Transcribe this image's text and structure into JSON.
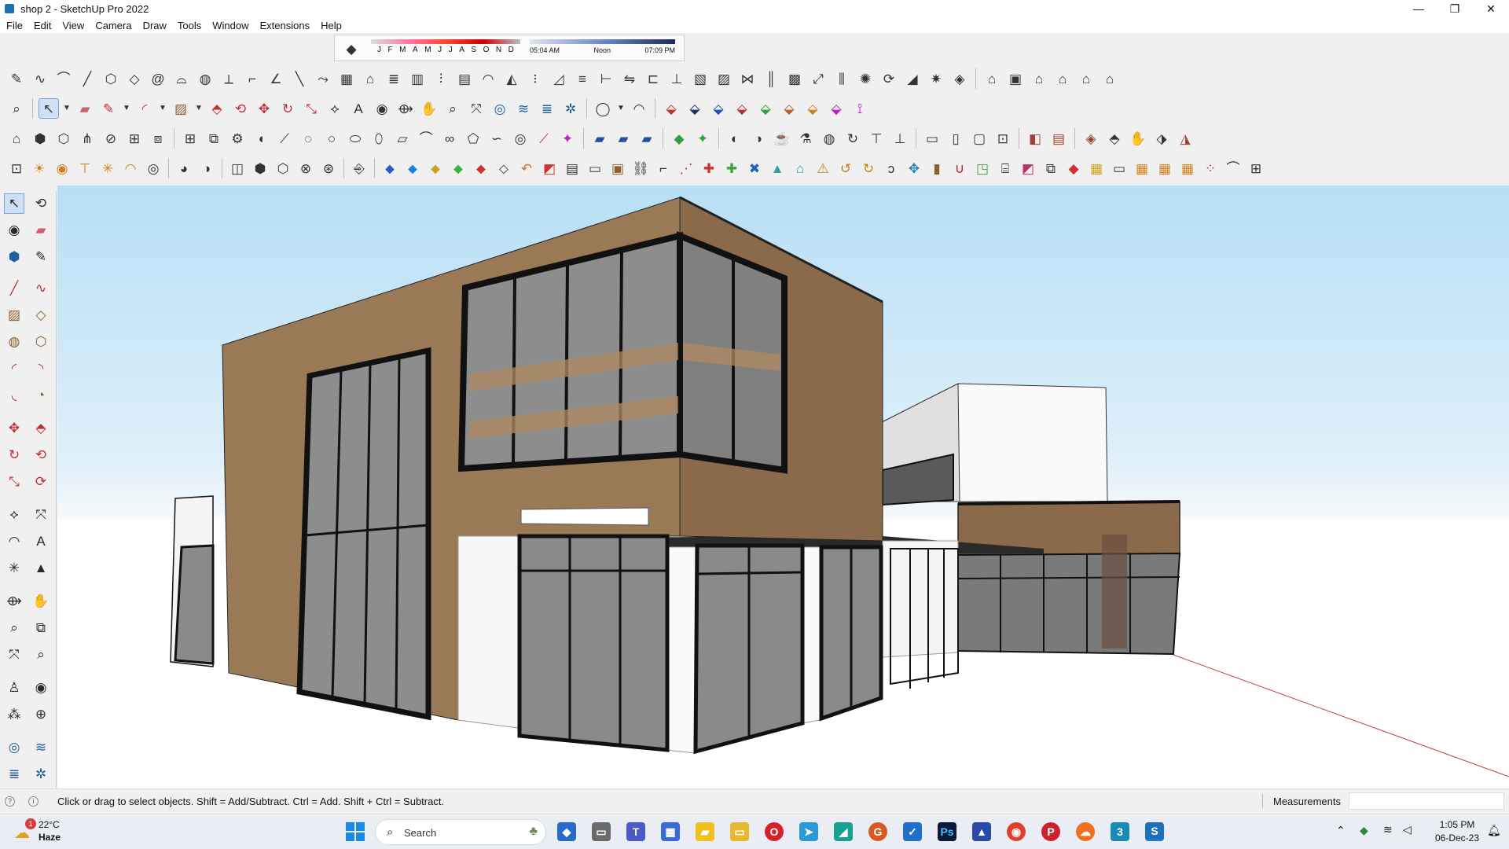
{
  "window": {
    "title": "shop 2 - SketchUp Pro 2022",
    "controls": [
      "—",
      "❐",
      "✕"
    ]
  },
  "menu": [
    "File",
    "Edit",
    "View",
    "Camera",
    "Draw",
    "Tools",
    "Window",
    "Extensions",
    "Help"
  ],
  "shadow_settings": {
    "months": [
      "J",
      "F",
      "M",
      "A",
      "M",
      "J",
      "J",
      "A",
      "S",
      "O",
      "N",
      "D"
    ],
    "time_start": "05:04 AM",
    "time_mid": "Noon",
    "time_end": "07:09 PM"
  },
  "status": {
    "hint": "Click or drag to select objects. Shift = Add/Subtract. Ctrl = Add. Shift + Ctrl = Subtract.",
    "measurements_label": "Measurements",
    "measurements_value": ""
  },
  "taskbar": {
    "weather_temp": "22°C",
    "weather_desc": "Haze",
    "weather_badge": "1",
    "search_label": "Search",
    "time": "1:05 PM",
    "date": "06-Dec-23"
  }
}
